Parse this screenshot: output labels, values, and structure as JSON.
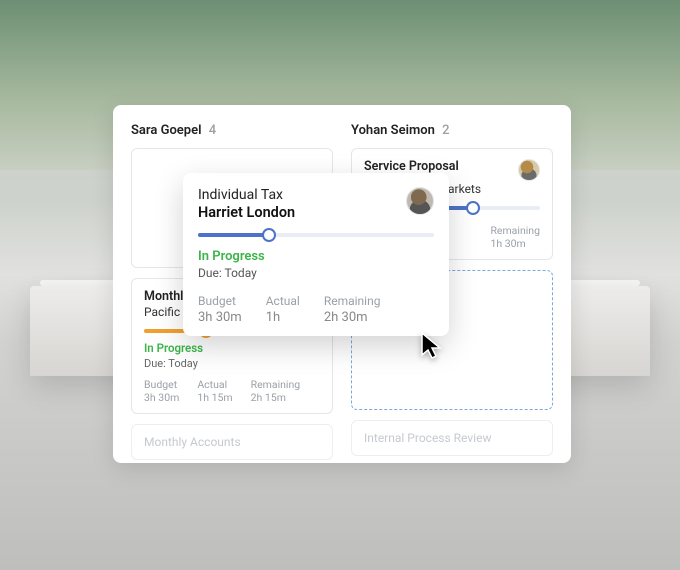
{
  "columns": [
    {
      "name": "Sara Goepel",
      "count": "4"
    },
    {
      "name": "Yohan Seimon",
      "count": "2"
    }
  ],
  "left_card": {
    "title": "Monthly Accou",
    "subtitle": "Pacific Coast",
    "status": "In Progress",
    "due": "Due: Today",
    "metrics": {
      "budget_label": "Budget",
      "budget_value": "3h 30m",
      "actual_label": "Actual",
      "actual_value": "1h 15m",
      "remaining_label": "Remaining",
      "remaining_value": "2h 15m"
    },
    "progress_color": "#f0a030",
    "progress_pct": 35
  },
  "left_ghost": {
    "title": "Monthly Accounts"
  },
  "right_card": {
    "title": "Service Proposal",
    "subtitle": "Farmer Fresh Markets",
    "remaining_label": "Remaining",
    "remaining_value": "1h 30m",
    "progress_color": "#4d72c9",
    "progress_pct": 62
  },
  "right_ghost": {
    "title": "Internal Process Review"
  },
  "detail": {
    "title": "Individual Tax",
    "name": "Harriet London",
    "status": "In Progress",
    "due": "Due: Today",
    "metrics": {
      "budget_label": "Budget",
      "budget_value": "3h 30m",
      "actual_label": "Actual",
      "actual_value": "1h",
      "remaining_label": "Remaining",
      "remaining_value": "2h 30m"
    },
    "progress_color": "#4d72c9",
    "progress_pct": 30
  }
}
